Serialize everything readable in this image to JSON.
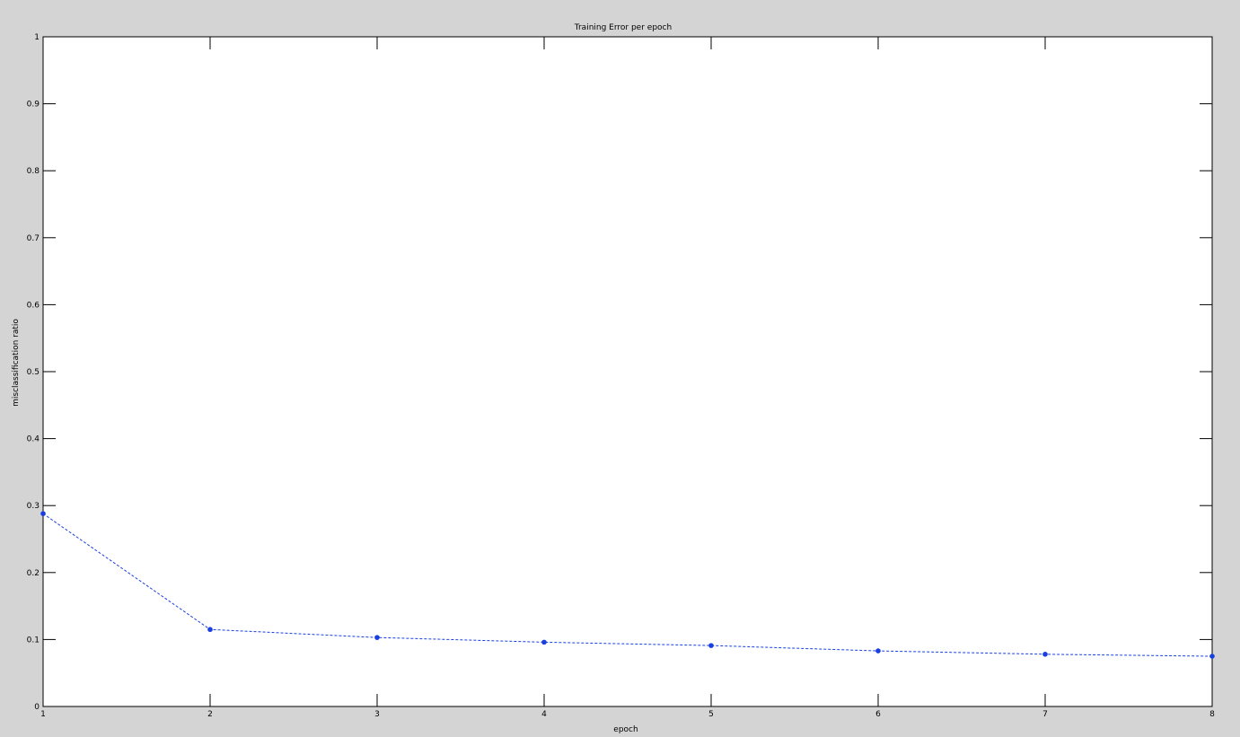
{
  "chart_data": {
    "type": "line",
    "title": "Training Error per epoch",
    "xlabel": "epoch",
    "ylabel": "misclassification ratio",
    "xlim": [
      1,
      8
    ],
    "ylim": [
      0,
      1
    ],
    "xticks": [
      1,
      2,
      3,
      4,
      5,
      6,
      7,
      8
    ],
    "yticks": [
      0,
      0.1,
      0.2,
      0.3,
      0.4,
      0.5,
      0.6,
      0.7,
      0.8,
      0.9,
      1
    ],
    "x": [
      1,
      2,
      3,
      4,
      5,
      6,
      7,
      8
    ],
    "series": [
      {
        "values": [
          0.288,
          0.115,
          0.103,
          0.096,
          0.091,
          0.083,
          0.078,
          0.075
        ],
        "color": "#1a3fe0",
        "line_style": "dashed",
        "marker": "dot"
      }
    ],
    "grid": false,
    "background": "#ffffff",
    "figure_background": "#d4d4d4"
  }
}
